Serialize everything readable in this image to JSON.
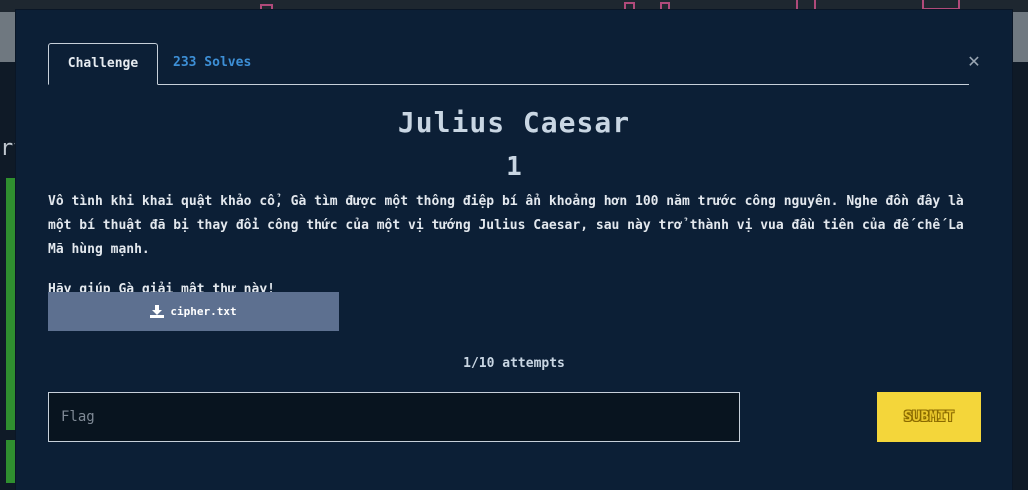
{
  "modal": {
    "close_glyph": "✕",
    "tabs": [
      {
        "label": "Challenge"
      },
      {
        "label": "233 Solves"
      }
    ],
    "title": "Julius Caesar",
    "points": "1",
    "description": [
      "Vô tình khi khai quật khảo cổ, Gà tìm được một thông điệp bí ẩn khoảng hơn 100 năm trước công nguyên. Nghe đồn đây là một bí thuật đã bị thay đổi công thức của một vị tướng Julius Caesar, sau này trở thành vị vua đầu tiên của đế chế La Mã hùng mạnh.",
      "Hãy giúp Gà giải mật thư này!"
    ],
    "file": {
      "label": "cipher.txt",
      "icon": "download-icon"
    },
    "attempts": "1/10 attempts",
    "flag_input": {
      "placeholder": "Flag",
      "value": ""
    },
    "submit_label": "SUBMIT"
  },
  "background": {
    "side_text": "ry"
  },
  "colors": {
    "modal_bg": "#0c1f36",
    "accent_link": "#3d8fd6",
    "file_button": "#5d7090",
    "submit": "#f4d63a"
  }
}
